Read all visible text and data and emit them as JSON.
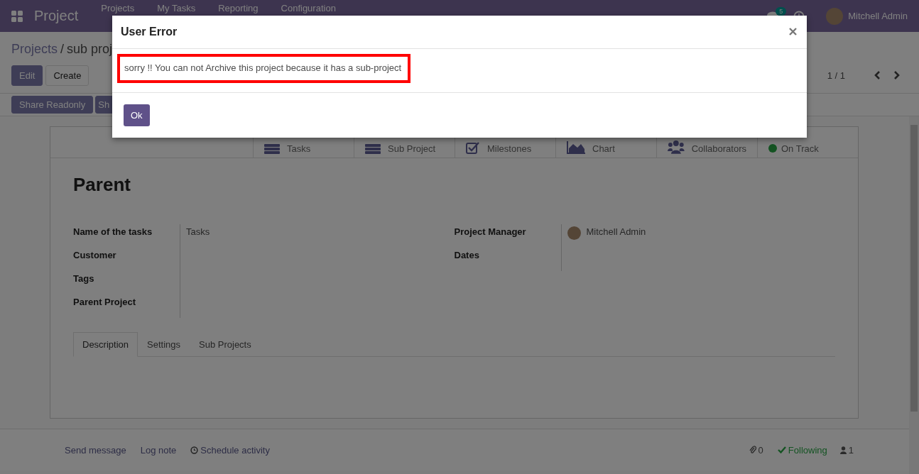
{
  "navbar": {
    "app_name": "Project",
    "menu": [
      "Projects",
      "My Tasks",
      "Reporting",
      "Configuration"
    ],
    "message_count": "5",
    "user": "Mitchell Admin"
  },
  "control_panel": {
    "breadcrumbs": [
      "Projects",
      "sub proj"
    ],
    "separator": "/",
    "buttons": [
      {
        "label": "Edit",
        "kind": "primary"
      },
      {
        "label": "Create",
        "kind": "secondary"
      }
    ],
    "pager": "1 / 1"
  },
  "action_buttons": [
    "Share Readonly",
    "Sh"
  ],
  "stat_buttons": [
    {
      "kind": "tasks",
      "label": "Tasks"
    },
    {
      "kind": "subprojects",
      "label": "Sub Project"
    },
    {
      "kind": "milestones",
      "label": "Milestones"
    },
    {
      "kind": "chart",
      "label": "Chart"
    },
    {
      "kind": "collaborators",
      "label": "Collaborators"
    },
    {
      "kind": "status",
      "label": "On Track"
    }
  ],
  "title": "Parent",
  "fields_left": [
    {
      "label": "Name of the tasks",
      "value": "Tasks"
    },
    {
      "label": "Customer"
    },
    {
      "label": "Tags"
    },
    {
      "label": "Parent Project"
    }
  ],
  "fields_right": [
    {
      "label": "Project Manager",
      "value": "Mitchell Admin",
      "avatar": true
    },
    {
      "label": "Dates"
    }
  ],
  "tabs": [
    {
      "label": "Description",
      "selected": true
    },
    {
      "label": "Settings",
      "selected": false
    },
    {
      "label": "Sub Projects",
      "selected": false
    }
  ],
  "chatter": {
    "actions": [
      "Send message",
      "Log note",
      "Schedule activity"
    ],
    "attachments": "0",
    "following": "Following",
    "followers": "1"
  },
  "dialog": {
    "title": "User Error",
    "message": "sorry !! You can not Archive this project because it has a sub-project",
    "highlighted": true,
    "buttons": [
      "Ok"
    ]
  }
}
